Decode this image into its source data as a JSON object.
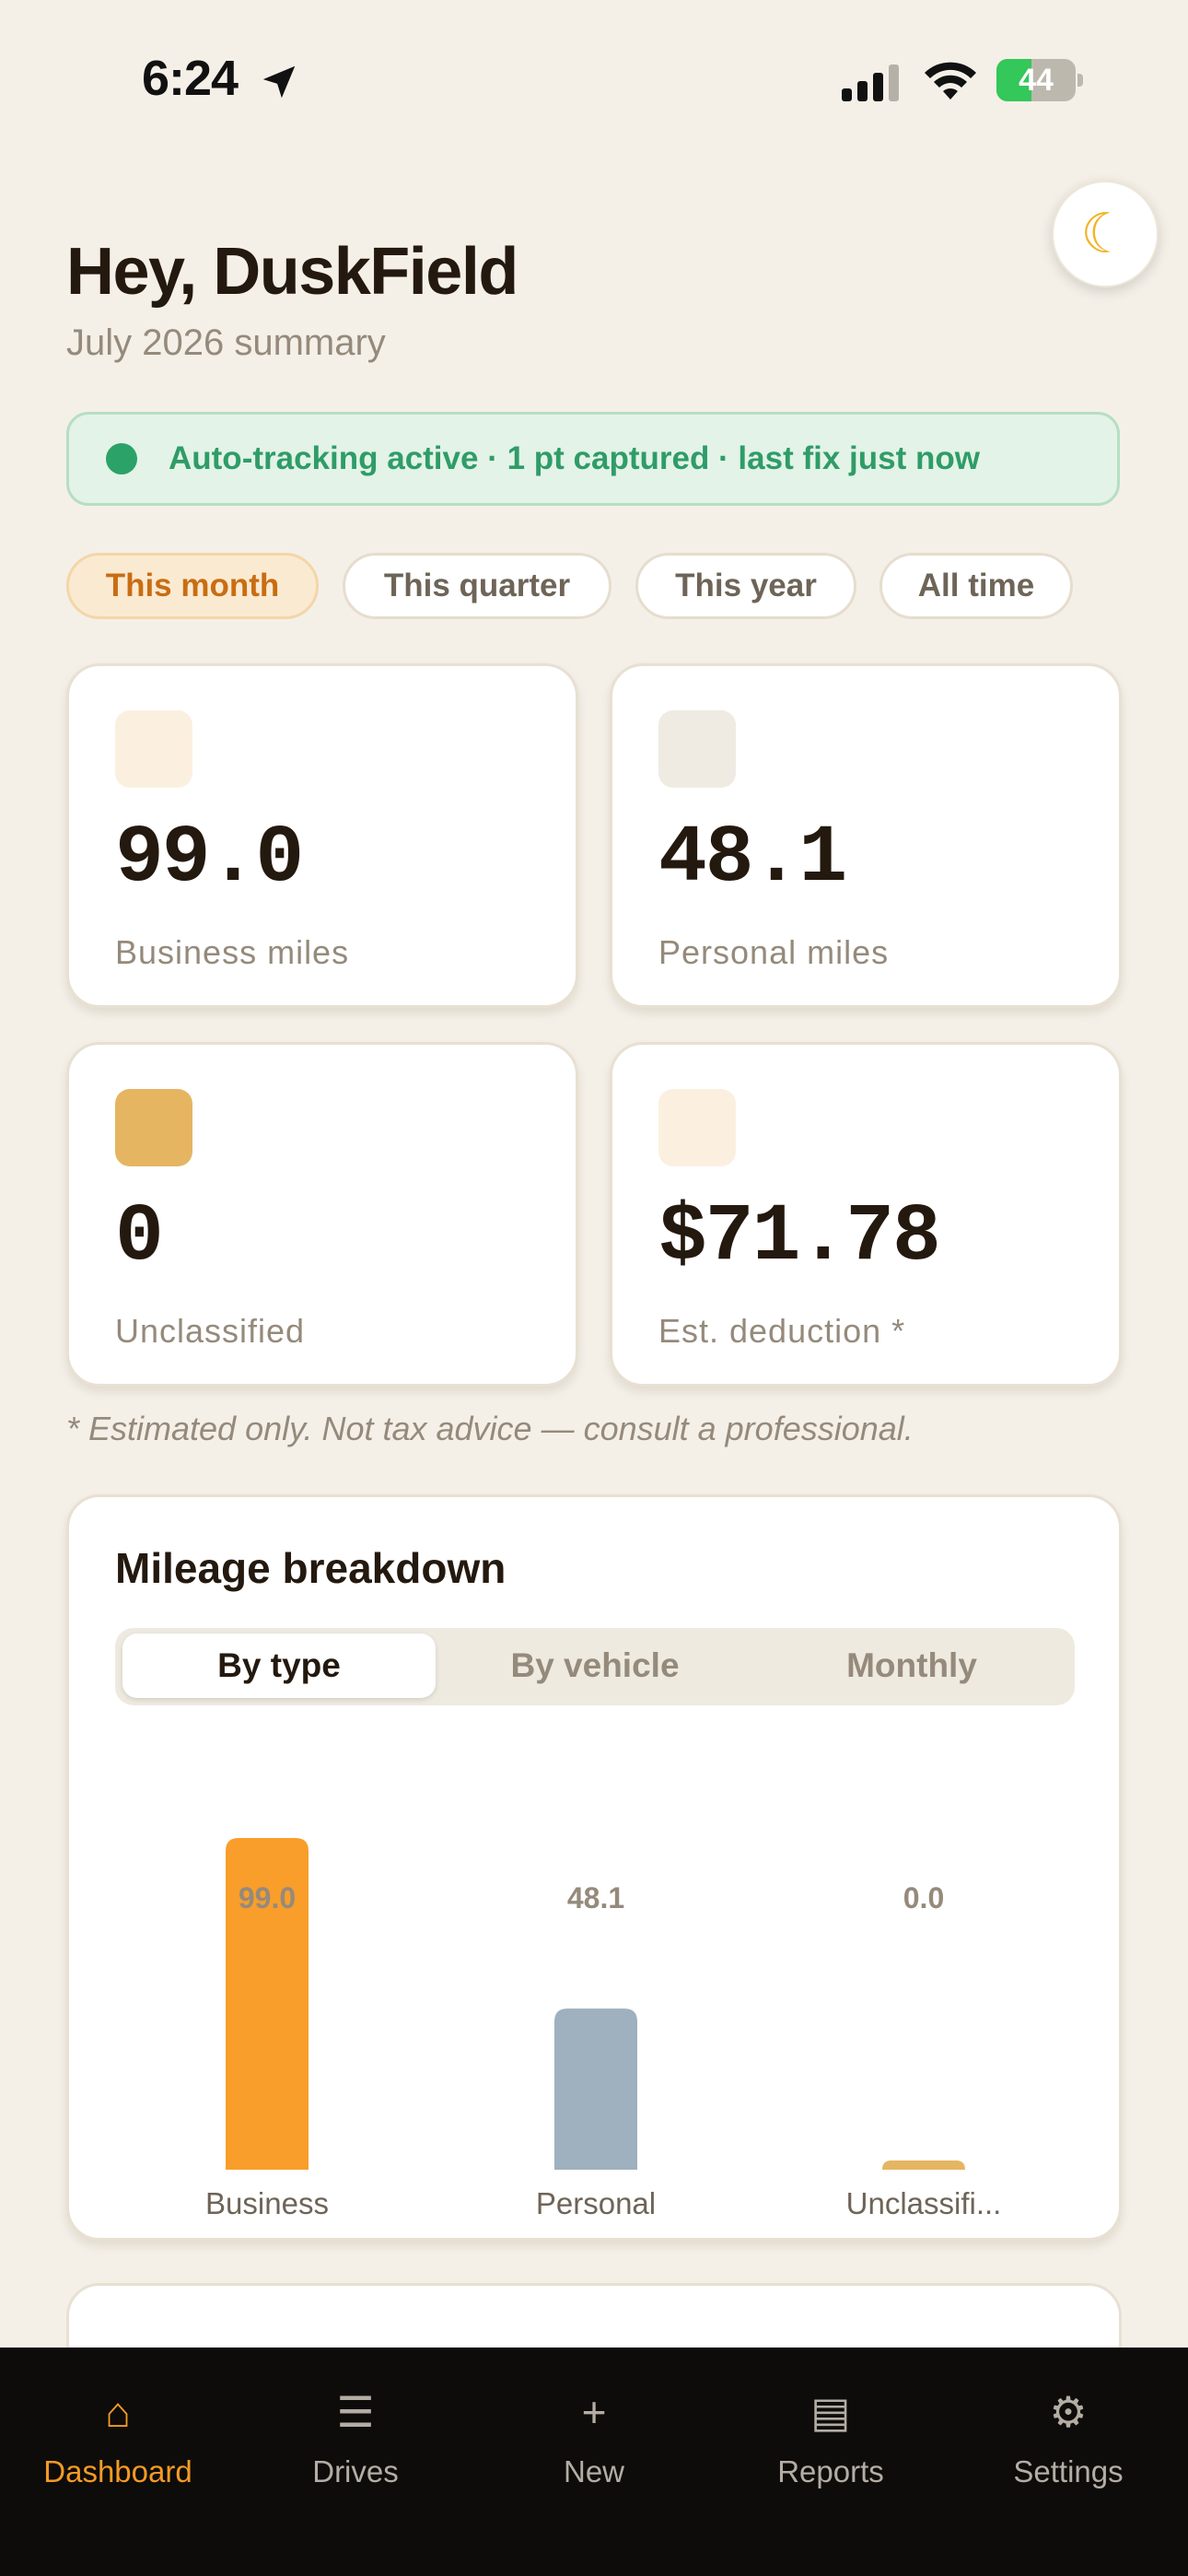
{
  "status_bar": {
    "time": "6:24",
    "battery": "44",
    "battery_level": 0.44
  },
  "header": {
    "greeting": "Hey, DuskField",
    "subtitle": "July 2026 summary"
  },
  "tracking_banner": {
    "text": "Auto-tracking active · 1 pt captured · last fix just now"
  },
  "period_filters": [
    {
      "label": "This month",
      "active": true
    },
    {
      "label": "This quarter",
      "active": false
    },
    {
      "label": "This year",
      "active": false
    },
    {
      "label": "All time",
      "active": false
    }
  ],
  "stats": [
    {
      "value": "99.0",
      "label": "Business miles",
      "icon_color": "#FBF0E0"
    },
    {
      "value": "48.1",
      "label": "Personal miles",
      "icon_color": "#EFEBE2"
    },
    {
      "value": "0",
      "label": "Unclassified",
      "icon_color": "#E5B562"
    },
    {
      "value": "$71.78",
      "label": "Est. deduction *",
      "icon_color": "#FBF0E0"
    }
  ],
  "disclaimer": "* Estimated only. Not tax advice — consult a professional.",
  "breakdown": {
    "title": "Mileage breakdown",
    "segments": [
      {
        "label": "By type",
        "active": true
      },
      {
        "label": "By vehicle",
        "active": false
      },
      {
        "label": "Monthly",
        "active": false
      }
    ]
  },
  "chart_data": {
    "type": "bar",
    "categories": [
      "Business",
      "Personal",
      "Unclassifi..."
    ],
    "values": [
      99.0,
      48.1,
      0.0
    ],
    "value_labels": [
      "99.0",
      "48.1",
      "0.0"
    ],
    "colors": [
      "#F99E2A",
      "#9FB0BE",
      "#E5B562"
    ],
    "title": "",
    "xlabel": "",
    "ylabel": "",
    "ylim": [
      0,
      99.0
    ],
    "grid": false,
    "legend": "none"
  },
  "tabbar": [
    {
      "label": "Dashboard",
      "icon": "⌂",
      "active": true
    },
    {
      "label": "Drives",
      "icon": "☰",
      "active": false
    },
    {
      "label": "New",
      "icon": "+",
      "active": false
    },
    {
      "label": "Reports",
      "icon": "▤",
      "active": false
    },
    {
      "label": "Settings",
      "icon": "⚙",
      "active": false
    }
  ]
}
